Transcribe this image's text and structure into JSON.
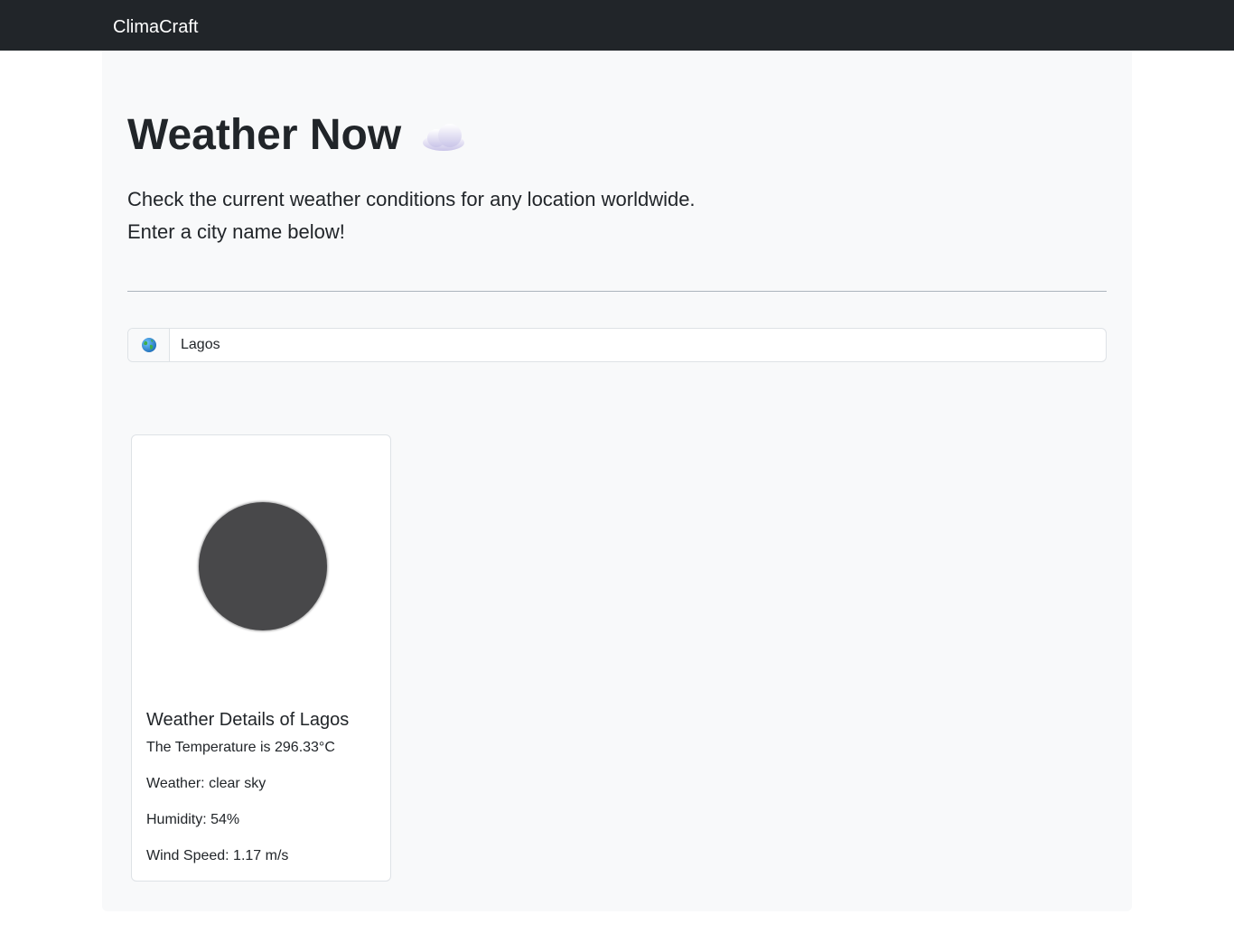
{
  "navbar": {
    "brand": "ClimaCraft"
  },
  "hero": {
    "title": "Weather Now",
    "title_icon": "cloud-icon",
    "lead_line1": "Check the current weather conditions for any location worldwide.",
    "lead_line2": "Enter a city name below!"
  },
  "search": {
    "icon": "globe-icon",
    "value": "Lagos"
  },
  "result": {
    "image": "weather-condition-image",
    "title": "Weather Details of Lagos",
    "temperature": "The Temperature is 296.33°C",
    "weather": "Weather: clear sky",
    "humidity": "Humidity: 54%",
    "wind": "Wind Speed: 1.17 m/s"
  },
  "colors": {
    "navbar": "#212529",
    "page": "#f8f9fa",
    "card_image": "#48484a"
  }
}
